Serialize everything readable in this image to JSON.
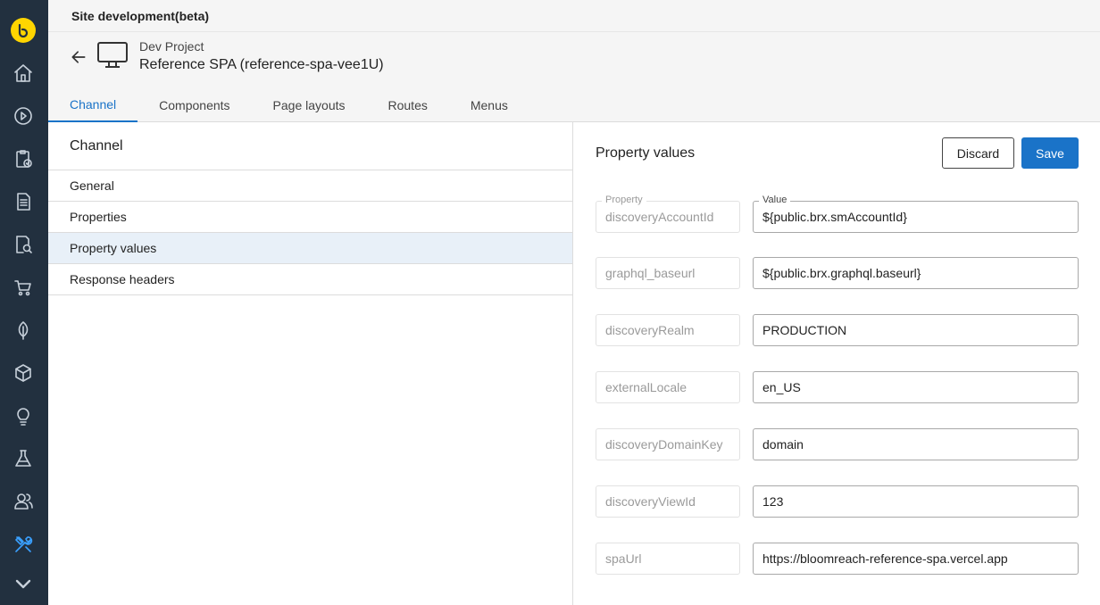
{
  "app": {
    "title": "Site development(beta)"
  },
  "rail": {
    "items": [
      {
        "icon": "home-icon"
      },
      {
        "icon": "play-icon"
      },
      {
        "icon": "clipboard-check-icon"
      },
      {
        "icon": "document-icon"
      },
      {
        "icon": "document-search-icon"
      },
      {
        "icon": "cart-icon"
      },
      {
        "icon": "leaf-icon"
      },
      {
        "icon": "cube-icon"
      },
      {
        "icon": "lightbulb-icon"
      },
      {
        "icon": "flask-icon"
      },
      {
        "icon": "users-icon"
      },
      {
        "icon": "tools-icon"
      },
      {
        "icon": "chevron-down-icon"
      }
    ],
    "active_color": "#3aa0ff"
  },
  "header": {
    "project": "Dev Project",
    "channel": "Reference SPA (reference-spa-vee1U)",
    "tabs": [
      {
        "label": "Channel",
        "active": true
      },
      {
        "label": "Components",
        "active": false
      },
      {
        "label": "Page layouts",
        "active": false
      },
      {
        "label": "Routes",
        "active": false
      },
      {
        "label": "Menus",
        "active": false
      }
    ]
  },
  "left": {
    "title": "Channel",
    "items": [
      {
        "label": "General",
        "selected": false
      },
      {
        "label": "Properties",
        "selected": false
      },
      {
        "label": "Property values",
        "selected": true
      },
      {
        "label": "Response headers",
        "selected": false
      }
    ]
  },
  "right": {
    "title": "Property values",
    "discard_label": "Discard",
    "save_label": "Save",
    "property_label": "Property",
    "value_label": "Value",
    "rows": [
      {
        "key": "discoveryAccountId",
        "value": "${public.brx.smAccountId}"
      },
      {
        "key": "graphql_baseurl",
        "value": "${public.brx.graphql.baseurl}"
      },
      {
        "key": "discoveryRealm",
        "value": "PRODUCTION"
      },
      {
        "key": "externalLocale",
        "value": "en_US"
      },
      {
        "key": "discoveryDomainKey",
        "value": "domain"
      },
      {
        "key": "discoveryViewId",
        "value": "123"
      },
      {
        "key": "spaUrl",
        "value": "https://bloomreach-reference-spa.vercel.app"
      }
    ]
  },
  "colors": {
    "accent": "#1a73c8",
    "rail": "#22303f",
    "logo": "#ffd500"
  }
}
